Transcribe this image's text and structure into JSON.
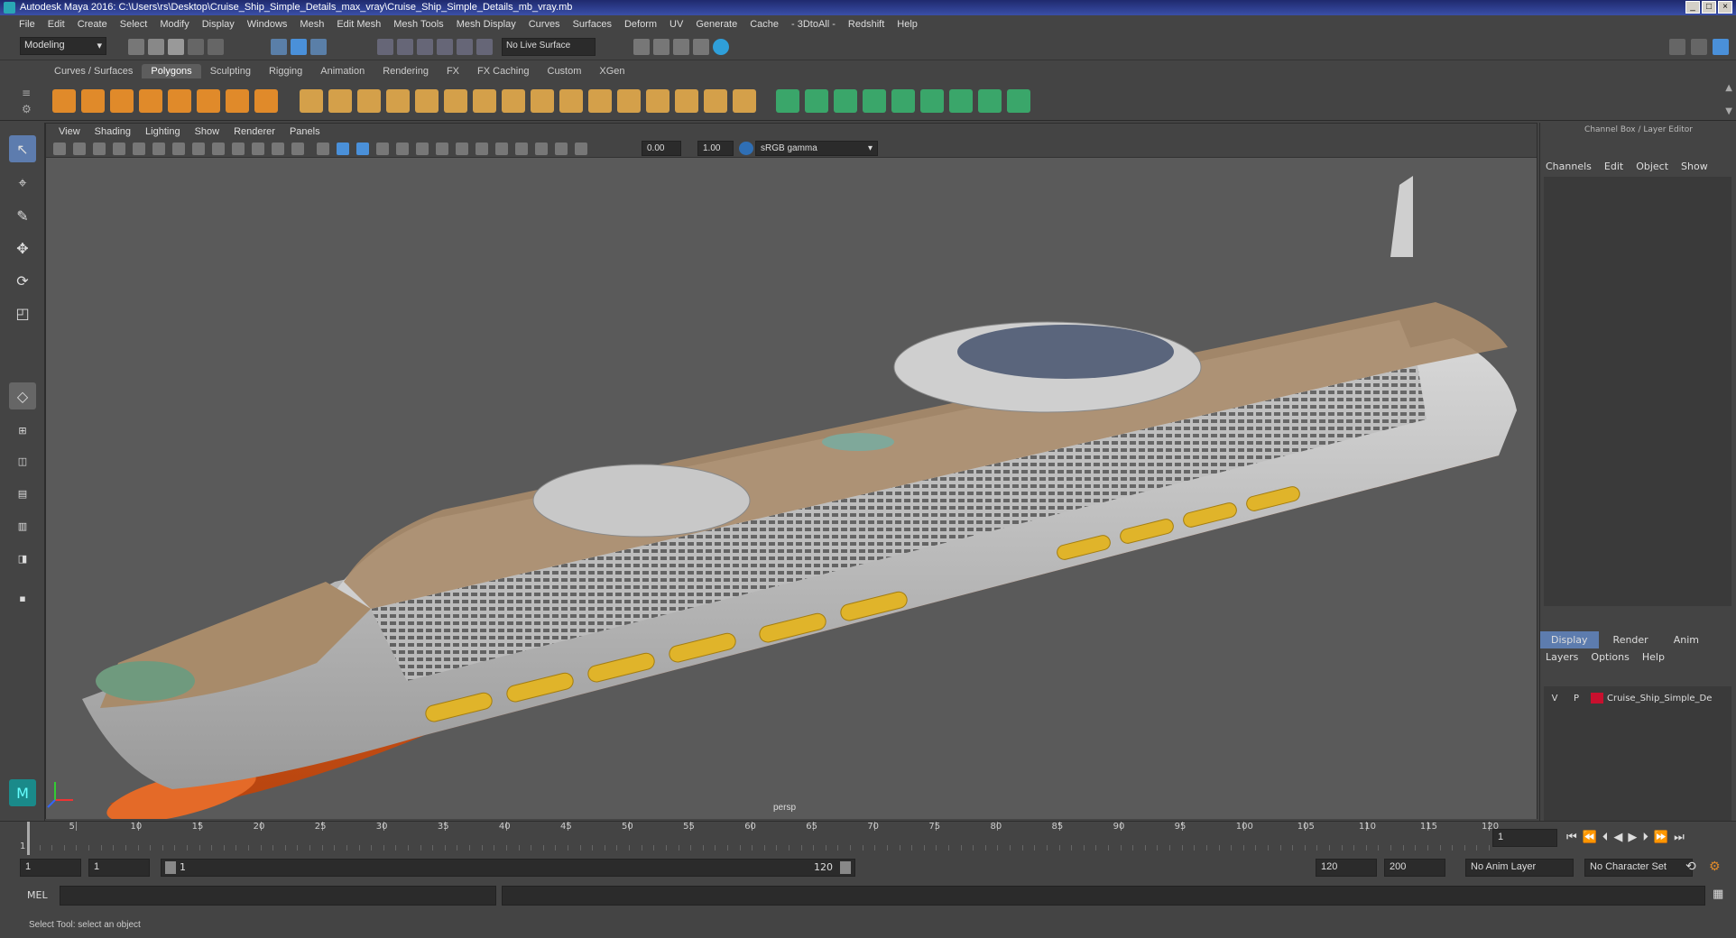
{
  "window": {
    "title": "Autodesk Maya 2016: C:\\Users\\rs\\Desktop\\Cruise_Ship_Simple_Details_max_vray\\Cruise_Ship_Simple_Details_mb_vray.mb"
  },
  "menus": [
    "File",
    "Edit",
    "Create",
    "Select",
    "Modify",
    "Display",
    "Windows",
    "Mesh",
    "Edit Mesh",
    "Mesh Tools",
    "Mesh Display",
    "Curves",
    "Surfaces",
    "Deform",
    "UV",
    "Generate",
    "Cache",
    "- 3DtoAll -",
    "Redshift",
    "Help"
  ],
  "status": {
    "mode": "Modeling",
    "live_surface": "No Live Surface"
  },
  "shelf_tabs": [
    "Curves / Surfaces",
    "Polygons",
    "Sculpting",
    "Rigging",
    "Animation",
    "Rendering",
    "FX",
    "FX Caching",
    "Custom",
    "XGen"
  ],
  "shelf_active": "Polygons",
  "panel_menu": [
    "View",
    "Shading",
    "Lighting",
    "Show",
    "Renderer",
    "Panels"
  ],
  "panel_fields": {
    "exposure": "0.00",
    "gamma": "1.00",
    "colorspace": "sRGB gamma"
  },
  "viewport": {
    "camera_label": "persp"
  },
  "channel_box": {
    "title": "Channel Box / Layer Editor",
    "menus": [
      "Channels",
      "Edit",
      "Object",
      "Show"
    ],
    "layer_tabs": [
      "Display",
      "Render",
      "Anim"
    ],
    "layer_menus": [
      "Layers",
      "Options",
      "Help"
    ],
    "layer": {
      "v": "V",
      "p": "P",
      "name": "Cruise_Ship_Simple_De",
      "color": "#c8102e"
    }
  },
  "timeline": {
    "ticks": [
      "1",
      "5",
      "10",
      "15",
      "20",
      "25",
      "30",
      "35",
      "40",
      "45",
      "50",
      "55",
      "60",
      "65",
      "70",
      "75",
      "80",
      "85",
      "90",
      "95",
      "100",
      "105",
      "110",
      "115",
      "120"
    ],
    "current_frame": "1"
  },
  "range": {
    "start": "1",
    "playback_start": "1",
    "slider_start": "1",
    "slider_end": "120",
    "playback_end": "120",
    "end": "200",
    "anim_layer": "No Anim Layer",
    "character_set": "No Character Set"
  },
  "command": {
    "lang": "MEL"
  },
  "help_line": "Select Tool: select an object",
  "colors": {
    "accent_blue": "#2f6fb5",
    "hull_orange": "#d4581a",
    "lifeboat_yellow": "#e0b42a",
    "deck_tan": "#a88b6a"
  }
}
